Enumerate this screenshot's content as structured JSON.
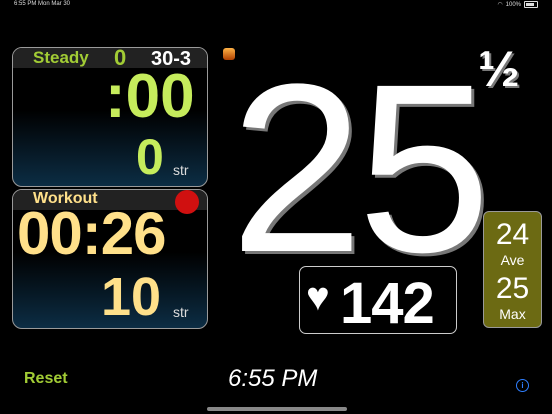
{
  "status_bar": {
    "time": "6:55 PM",
    "date": "Mon Mar 30",
    "battery": "100%"
  },
  "steady": {
    "title": "Steady",
    "count": "0",
    "ratio": "30-3",
    "time": ":00",
    "strokes": "0",
    "unit": "str"
  },
  "workout": {
    "title": "Workout",
    "time": "00:26",
    "strokes": "10",
    "unit": "str"
  },
  "rate": {
    "value": "25",
    "half": "½"
  },
  "heart_rate": {
    "value": "142"
  },
  "stats": {
    "ave_value": "24",
    "ave_label": "Ave",
    "max_value": "25",
    "max_label": "Max"
  },
  "bottom": {
    "reset_label": "Reset",
    "clock": "6:55 PM",
    "info_glyph": "i"
  },
  "colors": {
    "green": "#a2cc35",
    "yellow": "#ffe08a",
    "olive": "#6c6a13",
    "record": "#d01010"
  }
}
